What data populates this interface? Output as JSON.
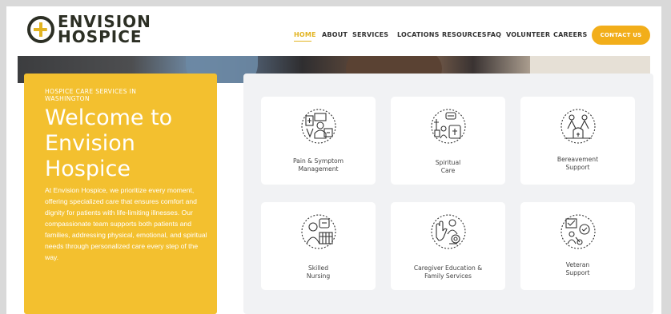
{
  "logo": {
    "line1": "ENVISION",
    "line2": "HOSPICE"
  },
  "nav": {
    "items": [
      "HOME",
      "ABOUT",
      "SERVICES",
      "LOCATIONS",
      "RESOURCES",
      "FAQ",
      "VOLUNTEER",
      "CAREERS"
    ],
    "active": "HOME",
    "cta": "CONTACT US"
  },
  "colors": {
    "accent": "#f3c02f",
    "cta": "#f2ae1a",
    "panel": "#f1f2f4"
  },
  "hero": {
    "eyebrow": "HOSPICE CARE SERVICES IN WASHINGTON",
    "title_l1": "Welcome to",
    "title_l2": "Envision",
    "title_l3": "Hospice",
    "intro": "At Envision Hospice, we prioritize every moment, offering specialized care that ensures comfort and dignity for patients with life-limiting illnesses. Our compassionate team supports both patients and families, addressing physical, emotional, and spiritual needs through personalized care every step of the way."
  },
  "services": [
    {
      "l1": "Pain & Symptom",
      "l2": "Management",
      "icon": "pain-symptom-icon"
    },
    {
      "l1": "Spiritual",
      "l2": "Care",
      "icon": "spiritual-care-icon"
    },
    {
      "l1": "Bereavement",
      "l2": "Support",
      "icon": "bereavement-icon"
    },
    {
      "l1": "Skilled",
      "l2": "Nursing",
      "icon": "skilled-nursing-icon"
    },
    {
      "l1": "Caregiver Education &",
      "l2": "Family Services",
      "icon": "caregiver-icon"
    },
    {
      "l1": "Veteran",
      "l2": "Support",
      "icon": "veteran-icon"
    }
  ]
}
